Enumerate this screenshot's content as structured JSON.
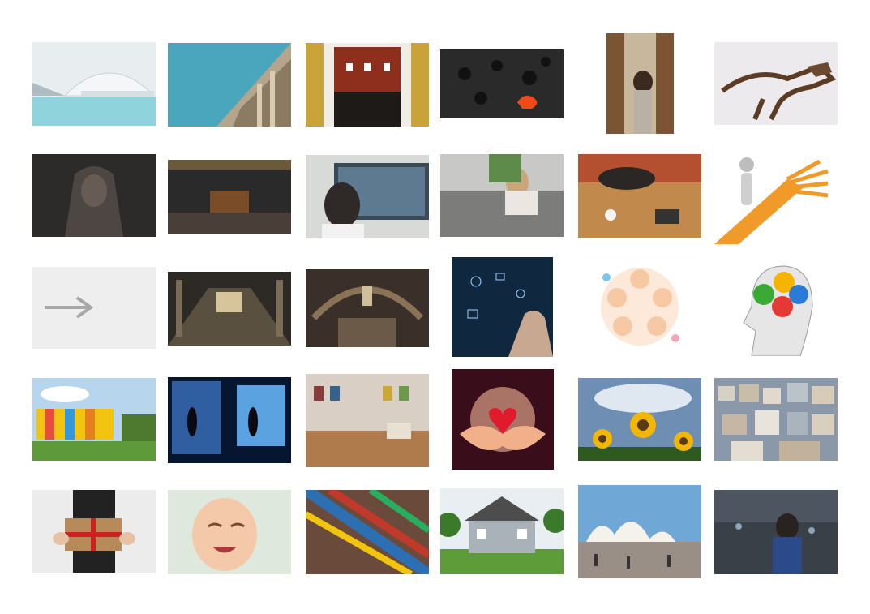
{
  "grid": {
    "tiles": [
      {
        "subject": "futuristic-white-architecture-over-water"
      },
      {
        "subject": "classical-building-corner-against-blue-sky"
      },
      {
        "subject": "gallery-room-with-red-walls"
      },
      {
        "subject": "black-question-marks-one-orange"
      },
      {
        "subject": "woman-reading-in-library-aisle"
      },
      {
        "subject": "dinosaur-skeleton-museum"
      },
      {
        "subject": "egyptian-sphinx-statue"
      },
      {
        "subject": "museum-hall-with-large-painting"
      },
      {
        "subject": "woman-looking-at-painting"
      },
      {
        "subject": "woman-working-on-couch-with-laptop"
      },
      {
        "subject": "people-at-wooden-table-with-devices"
      },
      {
        "subject": "figure-choosing-between-orange-arrows"
      },
      {
        "subject": "white-arrow-on-textured-wall"
      },
      {
        "subject": "museum-corridor-with-display-cases"
      },
      {
        "subject": "natural-history-museum-hall"
      },
      {
        "subject": "hand-touching-digital-icons"
      },
      {
        "subject": "circle-of-cartoon-children"
      },
      {
        "subject": "head-silhouette-with-gears"
      },
      {
        "subject": "colorful-panel-building-on-lawn"
      },
      {
        "subject": "people-in-dark-projection-room"
      },
      {
        "subject": "gallery-with-many-framed-pictures"
      },
      {
        "subject": "hands-holding-glowing-heart"
      },
      {
        "subject": "sunflower-field-under-clouds"
      },
      {
        "subject": "dense-city-hillside-houses"
      },
      {
        "subject": "hands-holding-wrapped-gift"
      },
      {
        "subject": "laughing-baby"
      },
      {
        "subject": "paint-tubes-and-brushes"
      },
      {
        "subject": "suburban-house-with-lawn"
      },
      {
        "subject": "sydney-opera-house-crowd"
      },
      {
        "subject": "child-with-backpack-in-street"
      }
    ]
  }
}
